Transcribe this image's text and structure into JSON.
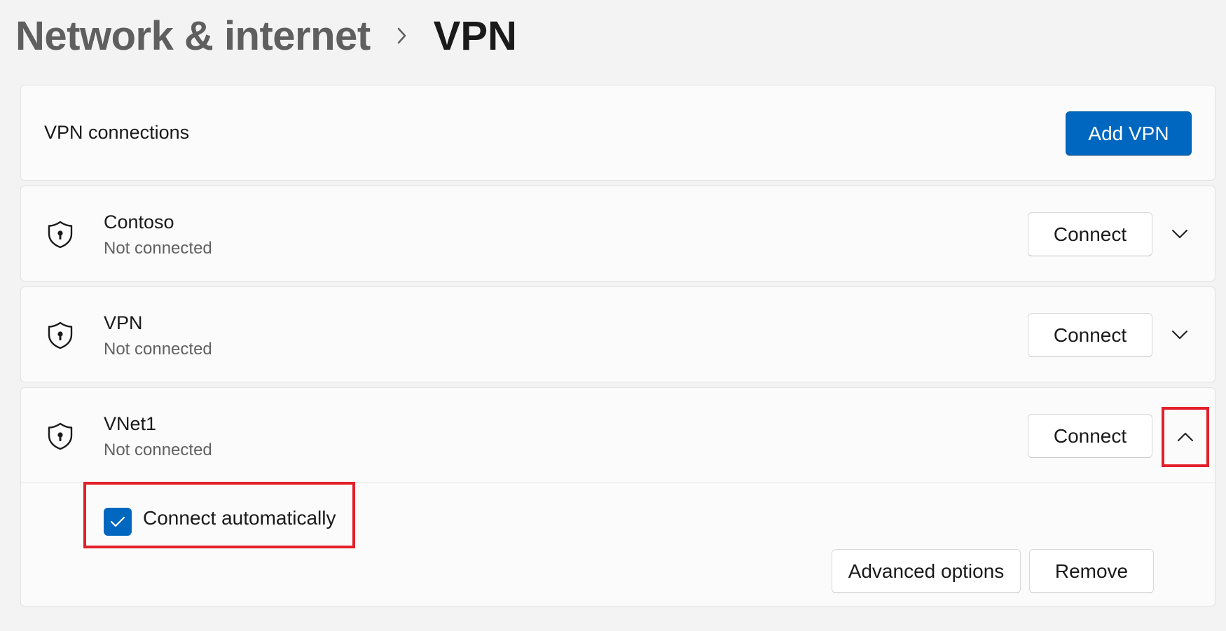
{
  "breadcrumb": {
    "parent": "Network & internet",
    "separator_icon": "chevron-right-icon",
    "current": "VPN"
  },
  "vpn_connections": {
    "label": "VPN connections",
    "add_button": "Add VPN"
  },
  "connections": [
    {
      "name": "Contoso",
      "status": "Not connected",
      "connect_label": "Connect",
      "icon": "shield-lock-icon",
      "expanded": false
    },
    {
      "name": "VPN",
      "status": "Not connected",
      "connect_label": "Connect",
      "icon": "shield-lock-icon",
      "expanded": false
    },
    {
      "name": "VNet1",
      "status": "Not connected",
      "connect_label": "Connect",
      "icon": "shield-lock-icon",
      "expanded": true,
      "connect_automatically": {
        "label": "Connect automatically",
        "checked": true
      },
      "advanced_options_label": "Advanced options",
      "remove_label": "Remove"
    }
  ],
  "colors": {
    "accent": "#0067c0",
    "highlight": "#e3202a",
    "background": "#f3f3f3",
    "card": "#fbfbfb"
  }
}
